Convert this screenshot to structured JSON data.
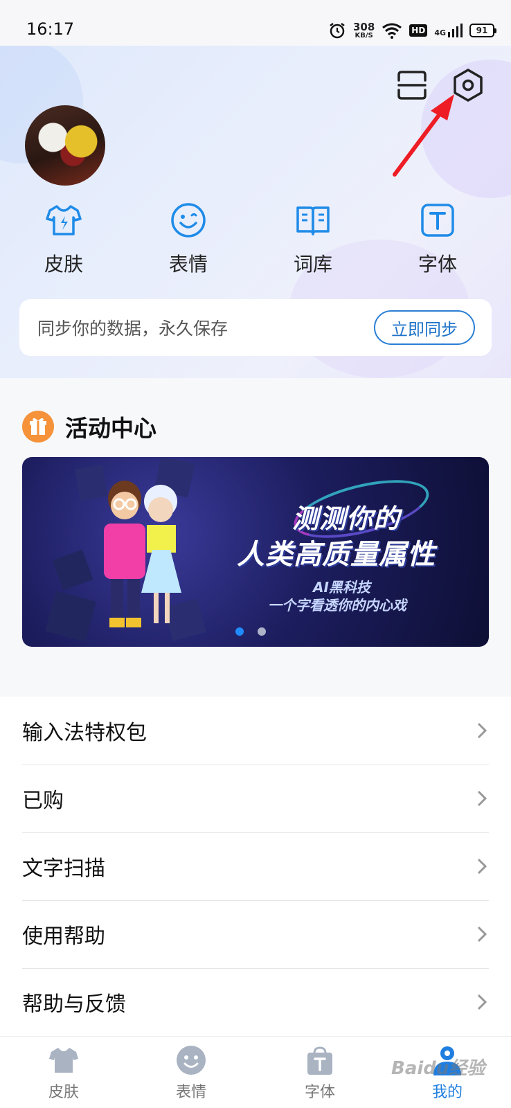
{
  "status_bar": {
    "time": "16:17",
    "net_speed_value": "308",
    "net_speed_unit": "KB/S",
    "hd_label": "HD",
    "network_label": "4G",
    "battery_level": "91"
  },
  "header": {
    "scan_icon": "scan-icon",
    "settings_icon": "settings-hexagon-icon"
  },
  "quick_actions": [
    {
      "label": "皮肤",
      "icon": "tshirt-icon"
    },
    {
      "label": "表情",
      "icon": "smile-icon"
    },
    {
      "label": "词库",
      "icon": "book-icon"
    },
    {
      "label": "字体",
      "icon": "font-t-icon"
    }
  ],
  "sync_card": {
    "text": "同步你的数据，永久保存",
    "button_label": "立即同步"
  },
  "activity": {
    "title": "活动中心",
    "banner": {
      "headline_line1": "测测你的",
      "headline_line2": "人类高质量属性",
      "sub_line1": "AI黑科技",
      "sub_line2": "一个字看透你的内心戏",
      "page_count": 2,
      "active_page": 1
    }
  },
  "menu": [
    {
      "label": "输入法特权包"
    },
    {
      "label": "已购"
    },
    {
      "label": "文字扫描"
    },
    {
      "label": "使用帮助"
    },
    {
      "label": "帮助与反馈"
    }
  ],
  "tabs": [
    {
      "label": "皮肤",
      "icon": "tshirt-icon",
      "active": false
    },
    {
      "label": "表情",
      "icon": "smile-icon",
      "active": false
    },
    {
      "label": "字体",
      "icon": "font-bag-icon",
      "active": false
    },
    {
      "label": "我的",
      "icon": "user-icon",
      "active": true
    }
  ],
  "watermark": "Baidu经验",
  "colors": {
    "accent": "#1f7ee0",
    "icon_blue": "#1f8be8",
    "gift_orange": "#f5923a",
    "arrow_red": "#ee1c24"
  }
}
